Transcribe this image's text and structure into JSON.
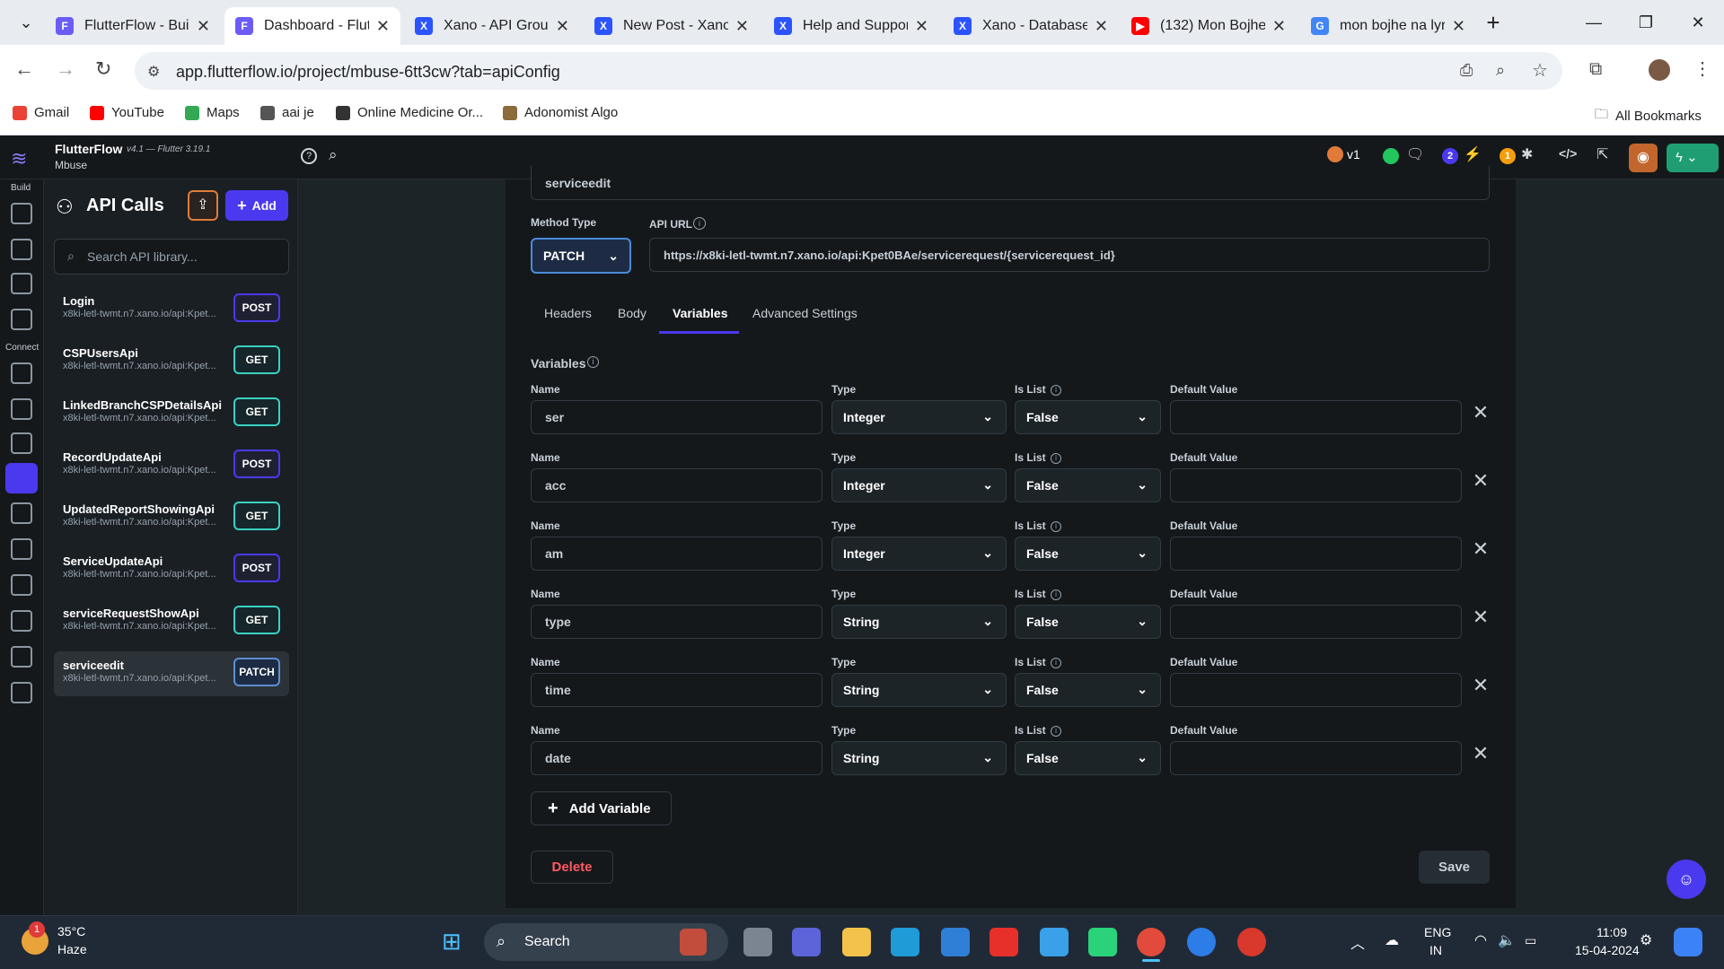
{
  "browser": {
    "tabs": [
      {
        "title": "FlutterFlow - Build",
        "color": "#6b5cf6",
        "glyph": "F"
      },
      {
        "title": "Dashboard - Flutte",
        "color": "#6b5cf6",
        "glyph": "F"
      },
      {
        "title": "Xano - API Group",
        "color": "#2b54ff",
        "glyph": "X"
      },
      {
        "title": "New Post - Xano",
        "color": "#2b54ff",
        "glyph": "X"
      },
      {
        "title": "Help and Support",
        "color": "#2b54ff",
        "glyph": "X"
      },
      {
        "title": "Xano - Database",
        "color": "#2b54ff",
        "glyph": "X"
      },
      {
        "title": "(132) Mon Bojhe",
        "color": "#ff0000",
        "glyph": "▶"
      },
      {
        "title": "mon bojhe na lyri",
        "color": "#4285f4",
        "glyph": "G"
      }
    ],
    "url": "app.flutterflow.io/project/mbuse-6tt3cw?tab=apiConfig",
    "bookmarks": [
      {
        "label": "Gmail",
        "color": "#ea4335"
      },
      {
        "label": "YouTube",
        "color": "#ff0000"
      },
      {
        "label": "Maps",
        "color": "#34a853"
      },
      {
        "label": "aai je",
        "color": "#555555"
      },
      {
        "label": "Online Medicine Or...",
        "color": "#333333"
      },
      {
        "label": "Adonomist Algo",
        "color": "#8a6d3b"
      }
    ],
    "all_bookmarks": "All Bookmarks"
  },
  "app": {
    "name": "FlutterFlow",
    "version": "v4.1 — Flutter 3.19.1",
    "project": "Mbuse",
    "rail_build": "Build",
    "rail_connect": "Connect",
    "version_badge": "v1",
    "count_blue": "2",
    "count_orange": "1"
  },
  "api_panel": {
    "title": "API Calls",
    "add_label": "Add",
    "search_placeholder": "Search API library...",
    "items": [
      {
        "name": "Login",
        "url": "x8ki-letl-twmt.n7.xano.io/api:Kpet...",
        "method": "POST"
      },
      {
        "name": "CSPUsersApi",
        "url": "x8ki-letl-twmt.n7.xano.io/api:Kpet...",
        "method": "GET"
      },
      {
        "name": "LinkedBranchCSPDetailsApi",
        "url": "x8ki-letl-twmt.n7.xano.io/api:Kpet...",
        "method": "GET"
      },
      {
        "name": "RecordUpdateApi",
        "url": "x8ki-letl-twmt.n7.xano.io/api:Kpet...",
        "method": "POST"
      },
      {
        "name": "UpdatedReportShowingApi",
        "url": "x8ki-letl-twmt.n7.xano.io/api:Kpet...",
        "method": "GET"
      },
      {
        "name": "ServiceUpdateApi",
        "url": "x8ki-letl-twmt.n7.xano.io/api:Kpet...",
        "method": "POST"
      },
      {
        "name": "serviceRequestShowApi",
        "url": "x8ki-letl-twmt.n7.xano.io/api:Kpet...",
        "method": "GET"
      },
      {
        "name": "serviceedit",
        "url": "x8ki-letl-twmt.n7.xano.io/api:Kpet...",
        "method": "PATCH"
      }
    ]
  },
  "editor": {
    "call_name": "serviceedit",
    "method_type_label": "Method Type",
    "method": "PATCH",
    "api_url_label": "API URL",
    "api_url": "https://x8ki-letl-twmt.n7.xano.io/api:Kpet0BAe/servicerequest/{servicerequest_id}",
    "tabs": [
      "Headers",
      "Body",
      "Variables",
      "Advanced Settings"
    ],
    "variables_title": "Variables",
    "col_name": "Name",
    "col_type": "Type",
    "col_islist": "Is List",
    "col_default": "Default Value",
    "variables": [
      {
        "name": "ser",
        "type": "Integer",
        "is_list": "False",
        "default": ""
      },
      {
        "name": "acc",
        "type": "Integer",
        "is_list": "False",
        "default": ""
      },
      {
        "name": "am",
        "type": "Integer",
        "is_list": "False",
        "default": ""
      },
      {
        "name": "type",
        "type": "String",
        "is_list": "False",
        "default": ""
      },
      {
        "name": "time",
        "type": "String",
        "is_list": "False",
        "default": ""
      },
      {
        "name": "date",
        "type": "String",
        "is_list": "False",
        "default": ""
      }
    ],
    "add_variable": "Add Variable",
    "delete": "Delete",
    "save": "Save"
  },
  "taskbar": {
    "weather_temp": "35°C",
    "weather_desc": "Haze",
    "weather_badge": "1",
    "search": "Search",
    "lang1": "ENG",
    "lang2": "IN",
    "time": "11:09",
    "date": "15-04-2024"
  }
}
